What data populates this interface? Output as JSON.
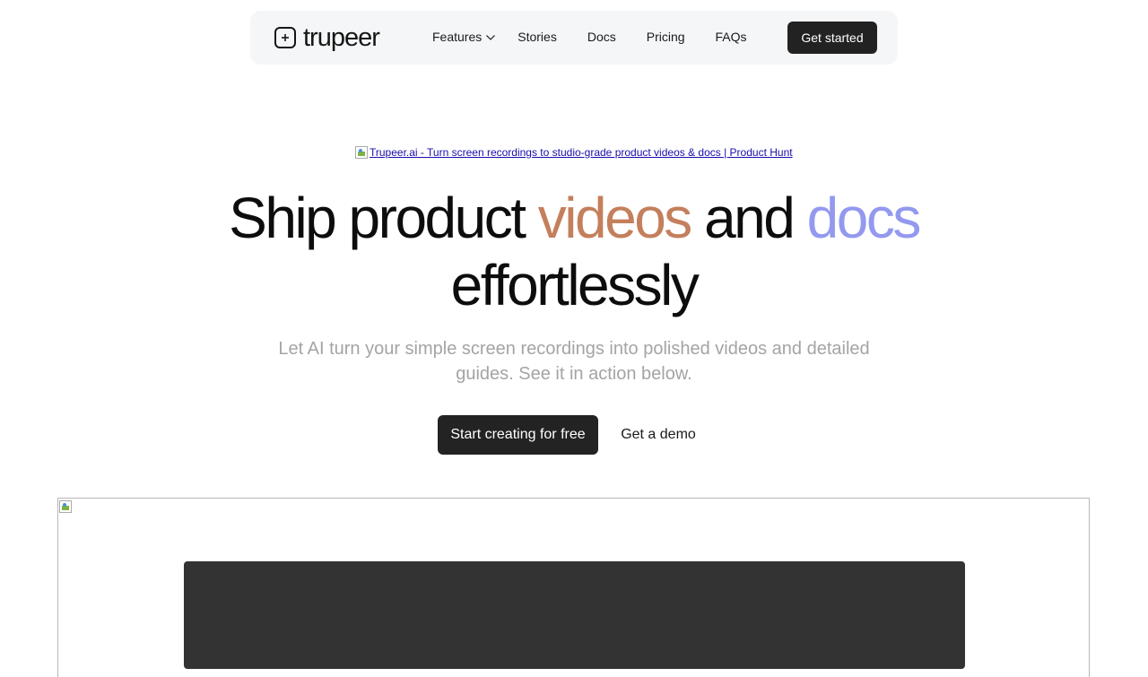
{
  "nav": {
    "logo_text": "trupeer",
    "links": [
      {
        "label": "Features",
        "has_dropdown": true
      },
      {
        "label": "Stories"
      },
      {
        "label": "Docs"
      },
      {
        "label": "Pricing"
      },
      {
        "label": "FAQs"
      }
    ],
    "cta_label": "Get started"
  },
  "badge": {
    "alt_text": "Trupeer.ai - Turn screen recordings to studio-grade product videos & docs | Product Hunt"
  },
  "hero": {
    "headline": {
      "part1": "Ship product ",
      "highlight1": "videos",
      "part2": " and ",
      "highlight2": "docs",
      "part3": "effortlessly"
    },
    "subtitle": "Let AI turn your simple screen recordings into polished videos and detailed guides. See it in action below.",
    "primary_cta": "Start creating for free",
    "secondary_cta": "Get a demo"
  },
  "colors": {
    "highlight_videos": "#c47f5c",
    "highlight_docs": "#9399ef",
    "button_dark": "#232323",
    "nav_bg": "#f5f6f8"
  },
  "icons": [
    "logo-icon",
    "chevron-down-icon",
    "broken-image-icon"
  ]
}
